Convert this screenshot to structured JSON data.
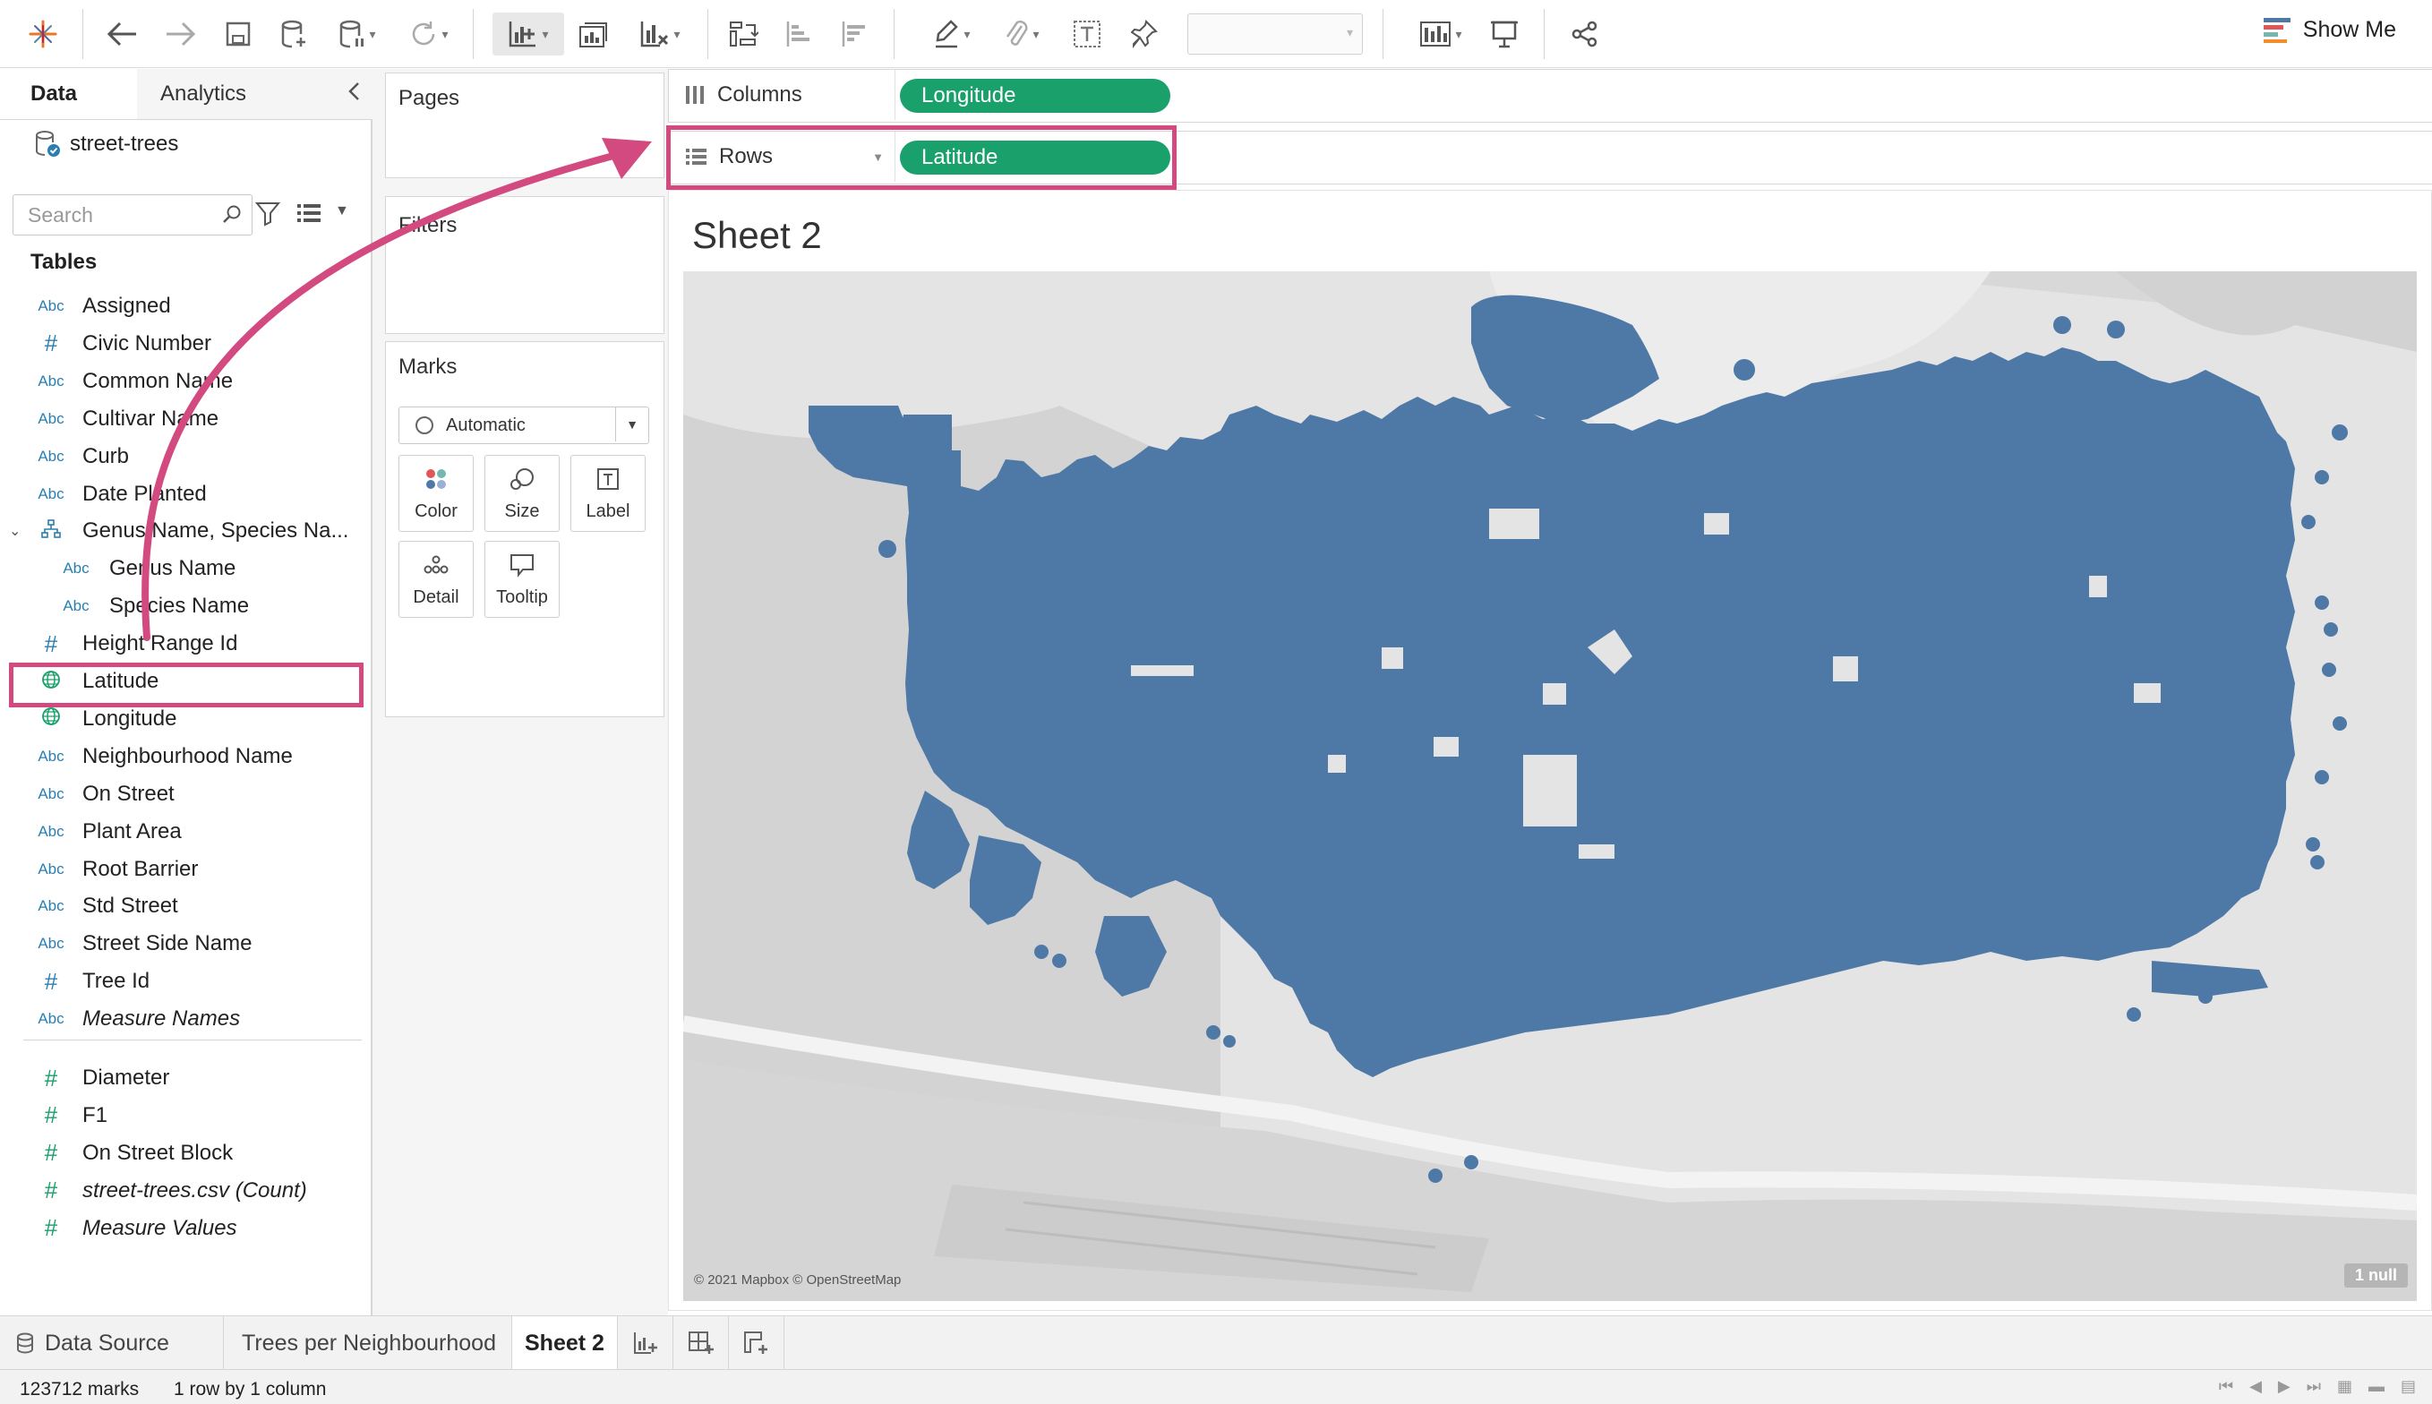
{
  "toolbar": {
    "show_me_label": "Show Me"
  },
  "data_pane": {
    "tabs": [
      "Data",
      "Analytics"
    ],
    "datasource": "street-trees",
    "search_placeholder": "Search",
    "tables_heading": "Tables",
    "fields": [
      {
        "type": "Abc",
        "name": "Assigned"
      },
      {
        "type": "#",
        "name": "Civic Number"
      },
      {
        "type": "Abc",
        "name": "Common Name"
      },
      {
        "type": "Abc",
        "name": "Cultivar Name"
      },
      {
        "type": "Abc",
        "name": "Curb"
      },
      {
        "type": "Abc",
        "name": "Date Planted"
      },
      {
        "type": "hier",
        "name": "Genus Name, Species Na..."
      },
      {
        "type": "Abc",
        "name": "Genus Name"
      },
      {
        "type": "Abc",
        "name": "Species Name"
      },
      {
        "type": "#",
        "name": "Height Range Id"
      },
      {
        "type": "geo",
        "name": "Latitude"
      },
      {
        "type": "geo",
        "name": "Longitude"
      },
      {
        "type": "Abc",
        "name": "Neighbourhood Name"
      },
      {
        "type": "Abc",
        "name": "On Street"
      },
      {
        "type": "Abc",
        "name": "Plant Area"
      },
      {
        "type": "Abc",
        "name": "Root Barrier"
      },
      {
        "type": "Abc",
        "name": "Std Street"
      },
      {
        "type": "Abc",
        "name": "Street Side Name"
      },
      {
        "type": "#",
        "name": "Tree Id"
      },
      {
        "type": "Abc",
        "name": "Measure Names"
      }
    ],
    "measures": [
      {
        "type": "#",
        "name": "Diameter"
      },
      {
        "type": "#",
        "name": "F1"
      },
      {
        "type": "#",
        "name": "On Street Block"
      },
      {
        "type": "#",
        "name": "street-trees.csv (Count)"
      },
      {
        "type": "#",
        "name": "Measure Values"
      }
    ]
  },
  "shelves": {
    "pages_title": "Pages",
    "filters_title": "Filters",
    "marks_title": "Marks",
    "mark_type": "Automatic",
    "mark_buttons": [
      "Color",
      "Size",
      "Label",
      "Detail",
      "Tooltip"
    ],
    "columns_label": "Columns",
    "columns_pill": "Longitude",
    "rows_label": "Rows",
    "rows_pill": "Latitude"
  },
  "view": {
    "sheet_title": "Sheet 2",
    "attribution": "© 2021 Mapbox © OpenStreetMap",
    "null_badge": "1 null",
    "mark_color": "#4e79a7"
  },
  "bottom_tabs": {
    "data_source": "Data Source",
    "sheets": [
      "Trees per Neighbourhood",
      "Sheet 2"
    ]
  },
  "status": {
    "marks": "123712 marks",
    "dimensions": "1 row by 1 column"
  },
  "colors": {
    "pill_green": "#1aa06b",
    "highlight_pink": "#d34a81",
    "abc_blue": "#2a7fb2"
  }
}
